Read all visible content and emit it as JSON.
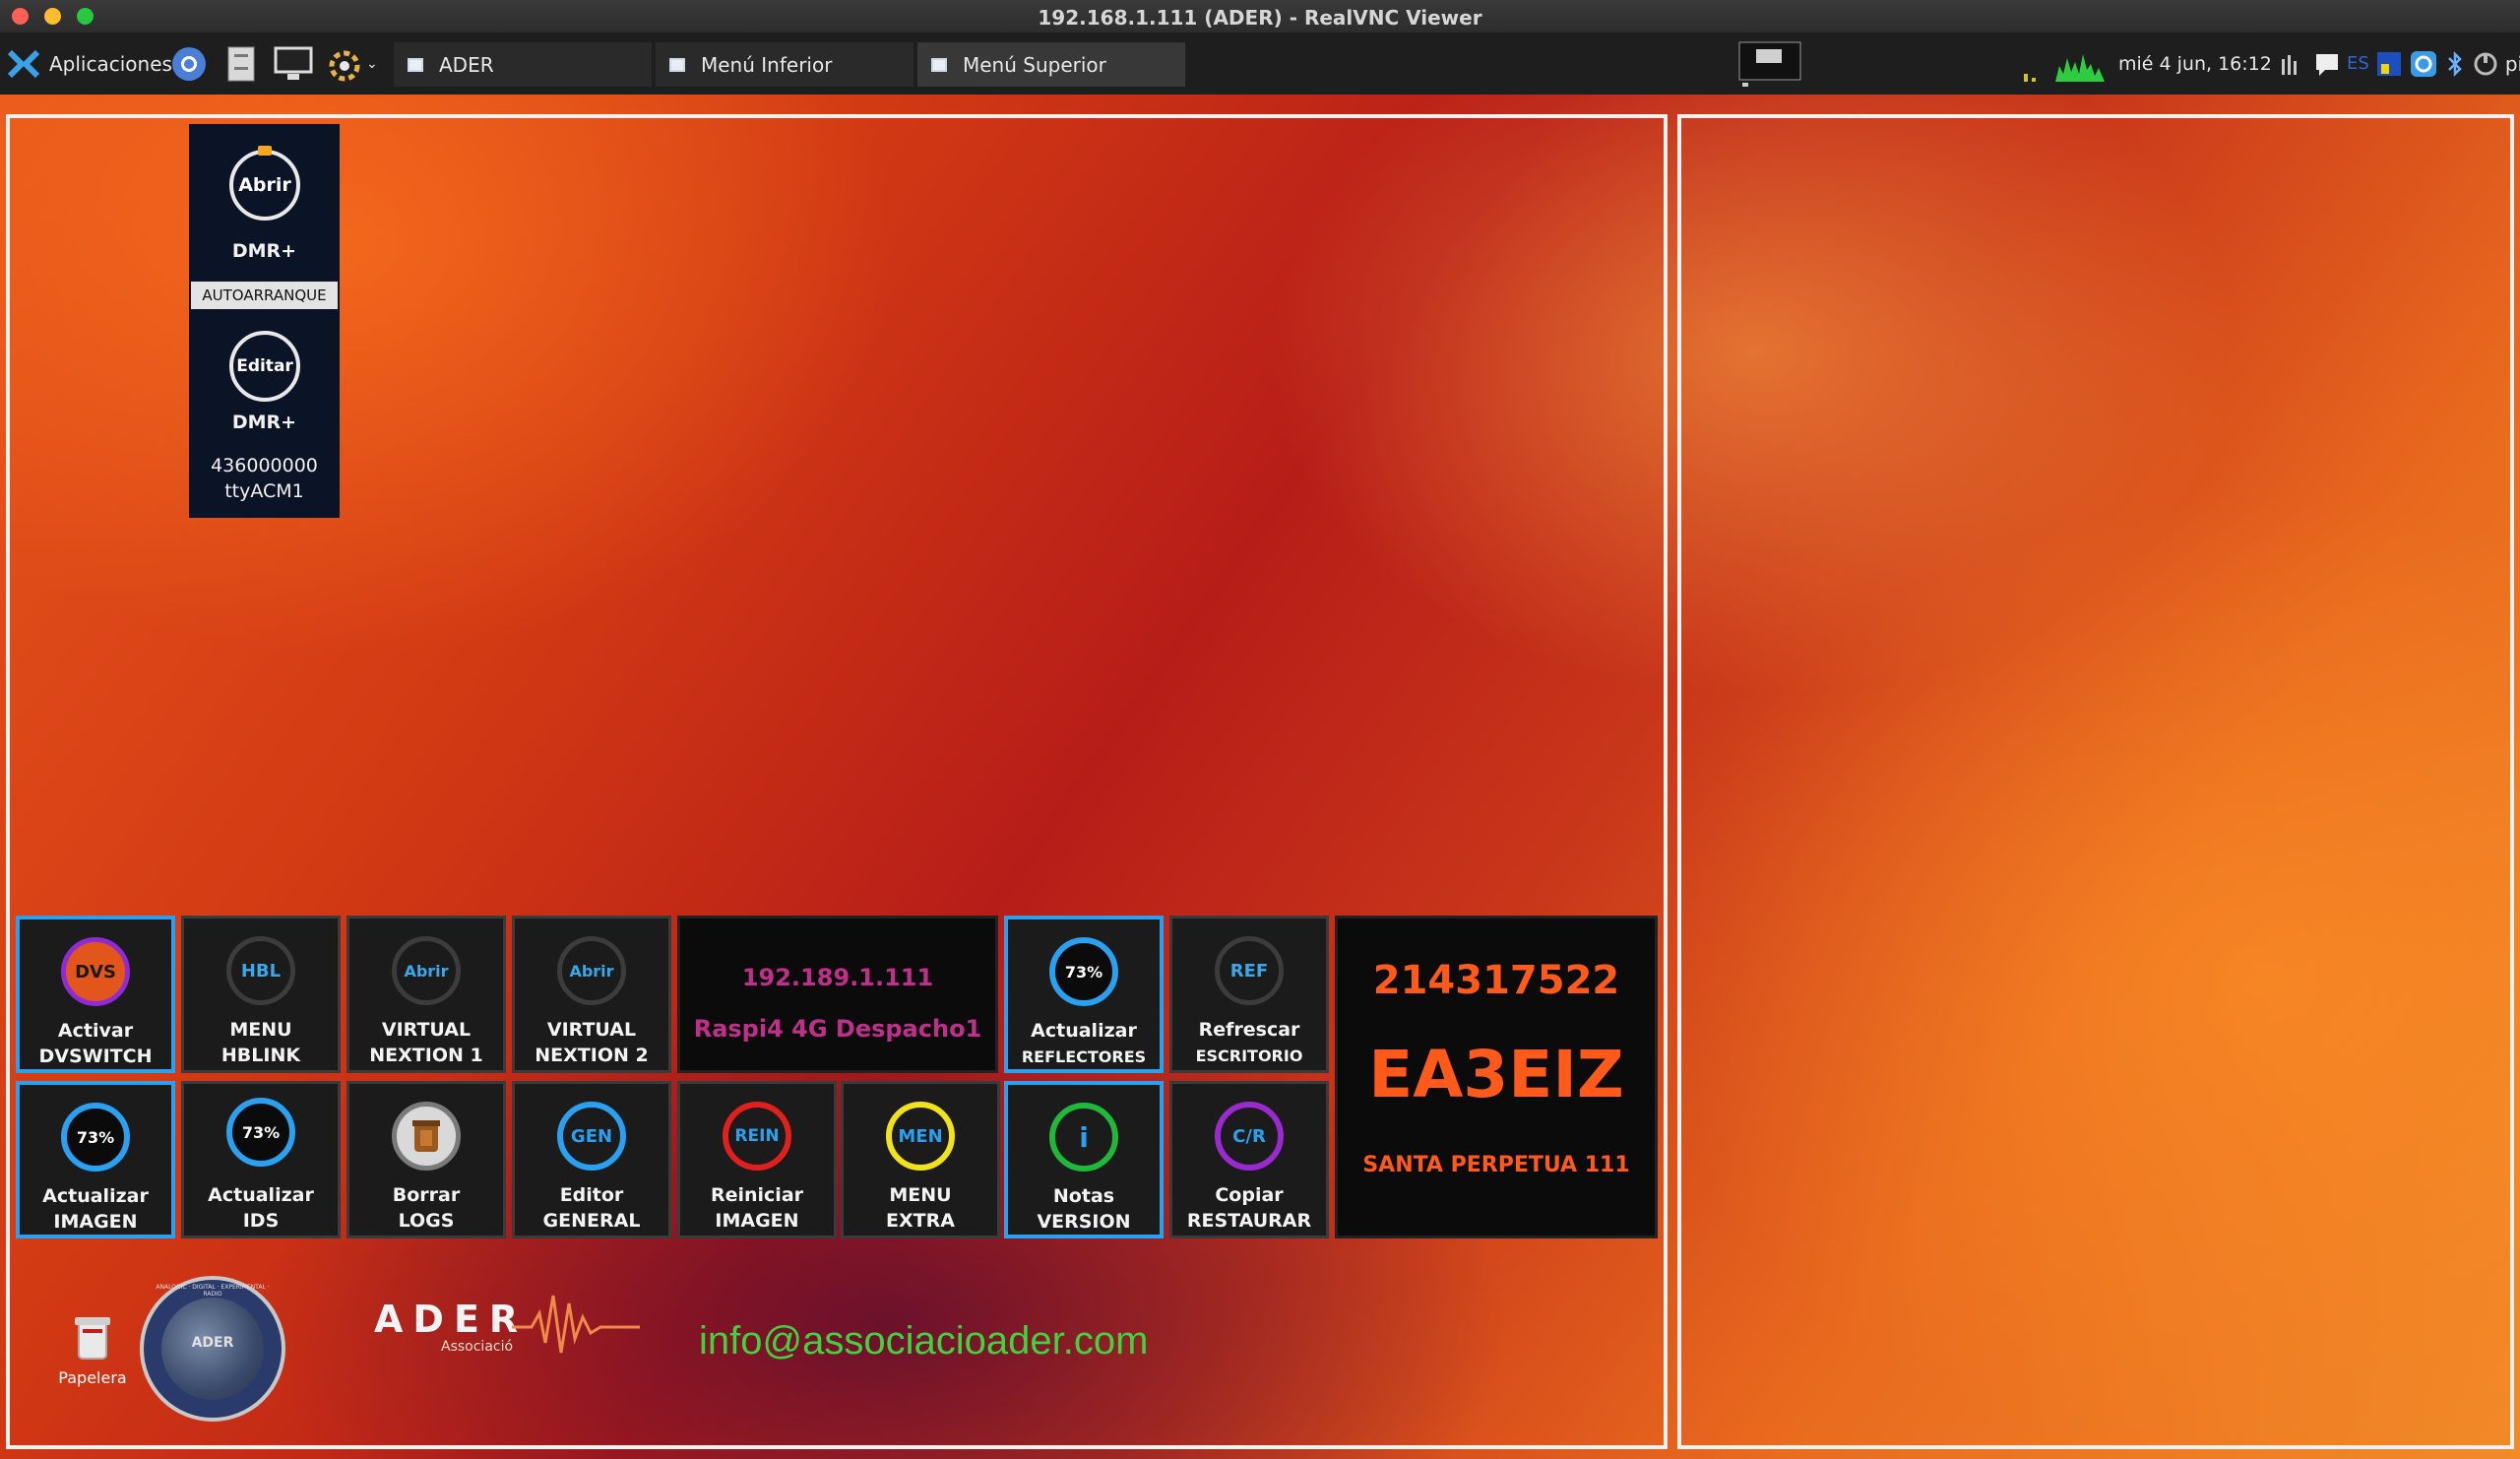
{
  "window": {
    "title": "192.168.1.111 (ADER) - RealVNC Viewer"
  },
  "taskbar": {
    "apps_label": "Aplicaciones",
    "windows": [
      "ADER",
      "Menú Inferior",
      "Menú Superior"
    ],
    "clock": "mié  4 jun, 16:12",
    "lang": "ES",
    "user": "pi"
  },
  "launcher": {
    "open_label": "Abrir",
    "open_caption": "DMR+",
    "autostart": "AUTOARRANQUE",
    "edit_label": "Editar",
    "edit_caption": "DMR+",
    "id_line": "436000000",
    "port_line": "ttyACM1"
  },
  "grid": {
    "row1": [
      {
        "icon": "DVS",
        "line1": "Activar",
        "line2": "DVSWITCH"
      },
      {
        "icon": "HBL",
        "line1": "MENU",
        "line2": "HBLINK"
      },
      {
        "icon": "Abrir",
        "line1": "VIRTUAL",
        "line2": "NEXTION 1"
      },
      {
        "icon": "Abrir",
        "line1": "VIRTUAL",
        "line2": "NEXTION 2"
      },
      {
        "icon": "73%",
        "line1": "Actualizar",
        "line2": "REFLECTORES"
      },
      {
        "icon": "REF",
        "line1": "Refrescar",
        "line2": "ESCRITORIO"
      }
    ],
    "row2": [
      {
        "icon": "73%",
        "line1": "Actualizar",
        "line2": "IMAGEN"
      },
      {
        "icon": "73%",
        "line1": "Actualizar",
        "line2": "IDS"
      },
      {
        "icon": "",
        "line1": "Borrar",
        "line2": "LOGS"
      },
      {
        "icon": "GEN",
        "line1": "Editor",
        "line2": "GENERAL"
      },
      {
        "icon": "REIN",
        "line1": "Reiniciar",
        "line2": "IMAGEN"
      },
      {
        "icon": "MEN",
        "line1": "MENU",
        "line2": "EXTRA"
      },
      {
        "icon": "i",
        "line1": "Notas",
        "line2": "VERSION"
      },
      {
        "icon": "C/R",
        "line1": "Copiar",
        "line2": "RESTAURAR"
      }
    ],
    "ip": "192.189.1.111",
    "host": "Raspi4 4G Despacho1",
    "dmr_id": "214317522",
    "callsign": "EA3EIZ",
    "location": "SANTA PERPETUA 111"
  },
  "desktop": {
    "trash_label": "Papelera",
    "seal_text": "ANALOGIC · DIGITAL · EXPERIMENTAL · RADIO",
    "seal_center": "ADER",
    "logo_text": "ADER",
    "logo_sub": "Associació",
    "email": "info@associacioader.com"
  },
  "colors": {
    "tile_highlight": "#2aa0f0",
    "email": "#3fd33f",
    "callsign": "#ff5a1a",
    "ip": "#c0308a"
  }
}
